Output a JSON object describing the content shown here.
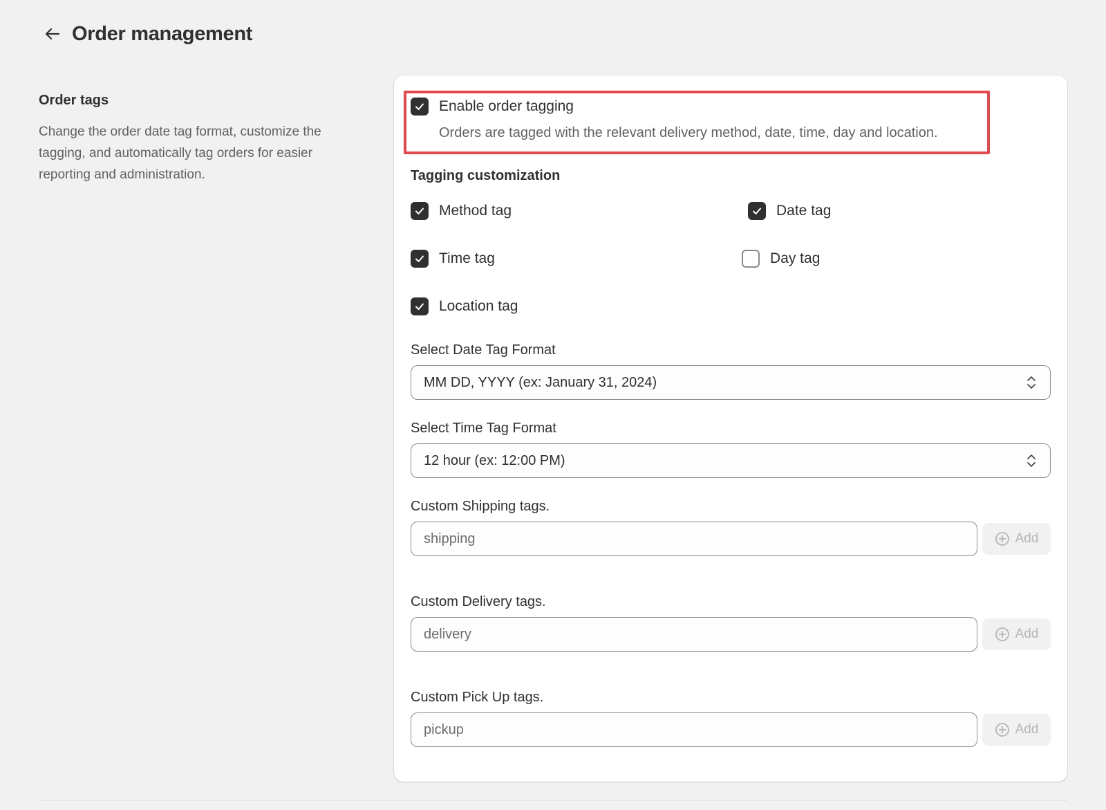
{
  "header": {
    "title": "Order management",
    "back_icon": "arrow-left-icon"
  },
  "section": {
    "title": "Order tags",
    "description": "Change the order date tag format, customize the tagging, and automatically tag orders for easier reporting and administration."
  },
  "enable_tagging": {
    "label": "Enable order tagging",
    "help": "Orders are tagged with the relevant delivery method, date, time, day and location.",
    "checked": true,
    "highlight_color": "#e5484d"
  },
  "customization": {
    "heading": "Tagging customization",
    "options": [
      {
        "label": "Method tag",
        "checked": true
      },
      {
        "label": "Date tag",
        "checked": true
      },
      {
        "label": "Time tag",
        "checked": true
      },
      {
        "label": "Day tag",
        "checked": false
      },
      {
        "label": "Location tag",
        "checked": true
      }
    ]
  },
  "date_format": {
    "label": "Select Date Tag Format",
    "value": "MM DD, YYYY (ex: January 31, 2024)"
  },
  "time_format": {
    "label": "Select Time Tag Format",
    "value": "12 hour (ex: 12:00 PM)"
  },
  "shipping_tags": {
    "label": "Custom Shipping tags.",
    "placeholder": "shipping",
    "add_label": "Add"
  },
  "delivery_tags": {
    "label": "Custom Delivery tags.",
    "placeholder": "delivery",
    "add_label": "Add"
  },
  "pickup_tags": {
    "label": "Custom Pick Up tags.",
    "placeholder": "pickup",
    "add_label": "Add"
  }
}
